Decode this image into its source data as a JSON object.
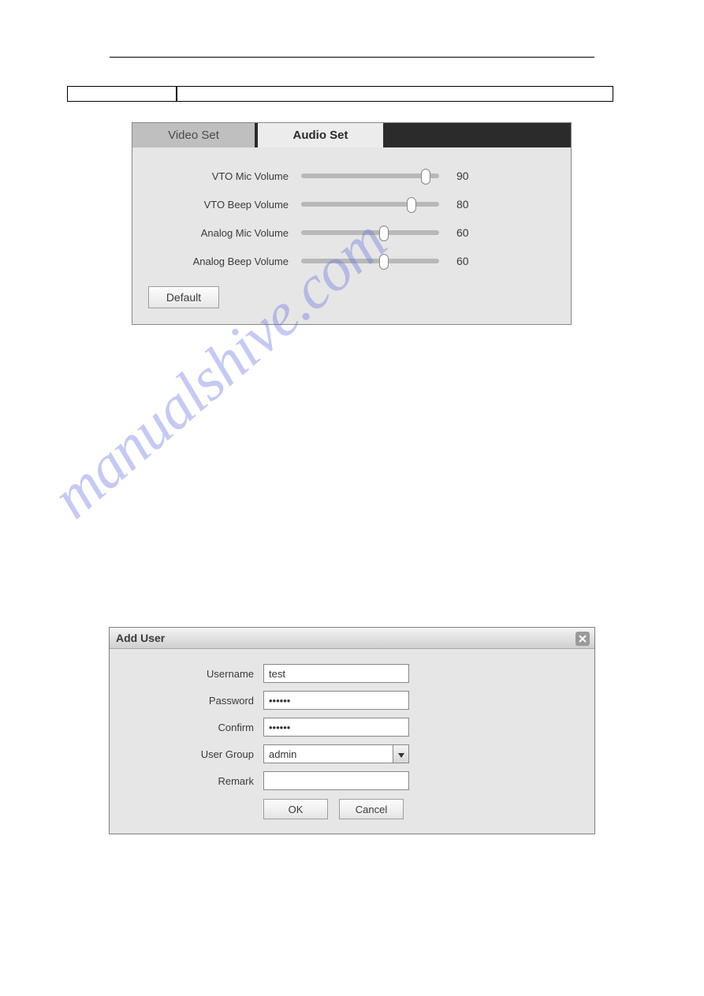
{
  "watermark": "manualshive.com",
  "empty_table": {
    "col1": "",
    "col2": ""
  },
  "audio_panel": {
    "tabs": {
      "video": "Video Set",
      "audio": "Audio Set"
    },
    "sliders": [
      {
        "label": "VTO Mic Volume",
        "value": 90,
        "min": 0,
        "max": 100
      },
      {
        "label": "VTO Beep Volume",
        "value": 80,
        "min": 0,
        "max": 100
      },
      {
        "label": "Analog Mic Volume",
        "value": 60,
        "min": 0,
        "max": 100
      },
      {
        "label": "Analog Beep Volume",
        "value": 60,
        "min": 0,
        "max": 100
      }
    ],
    "default_btn": "Default"
  },
  "add_user": {
    "title": "Add User",
    "fields": {
      "username_label": "Username",
      "username_value": "test",
      "password_label": "Password",
      "password_value": "••••••",
      "confirm_label": "Confirm",
      "confirm_value": "••••••",
      "group_label": "User Group",
      "group_value": "admin",
      "remark_label": "Remark",
      "remark_value": ""
    },
    "ok": "OK",
    "cancel": "Cancel"
  }
}
